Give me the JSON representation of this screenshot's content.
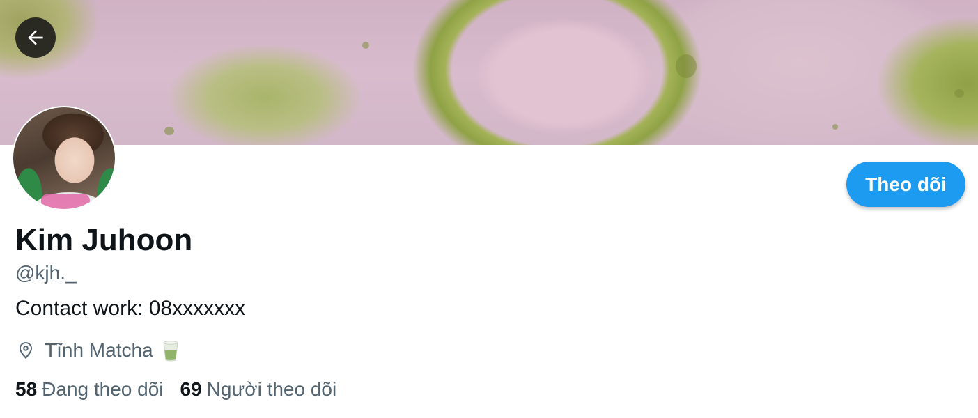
{
  "profile": {
    "name": "Kim Juhoon",
    "handle": "@kjh._",
    "bio": "Contact work: 08xxxxxxx",
    "location": "Tĩnh Matcha",
    "location_emoji_icon": "matcha-cup-icon"
  },
  "actions": {
    "follow_label": "Theo dõi",
    "back_icon": "arrow-left-icon"
  },
  "stats": {
    "following_count": "58",
    "following_label": "Đang theo dõi",
    "followers_count": "69",
    "followers_label": "Người theo dõi"
  },
  "colors": {
    "accent": "#1d9bf0",
    "text_primary": "#0f1419",
    "text_secondary": "#536471"
  }
}
